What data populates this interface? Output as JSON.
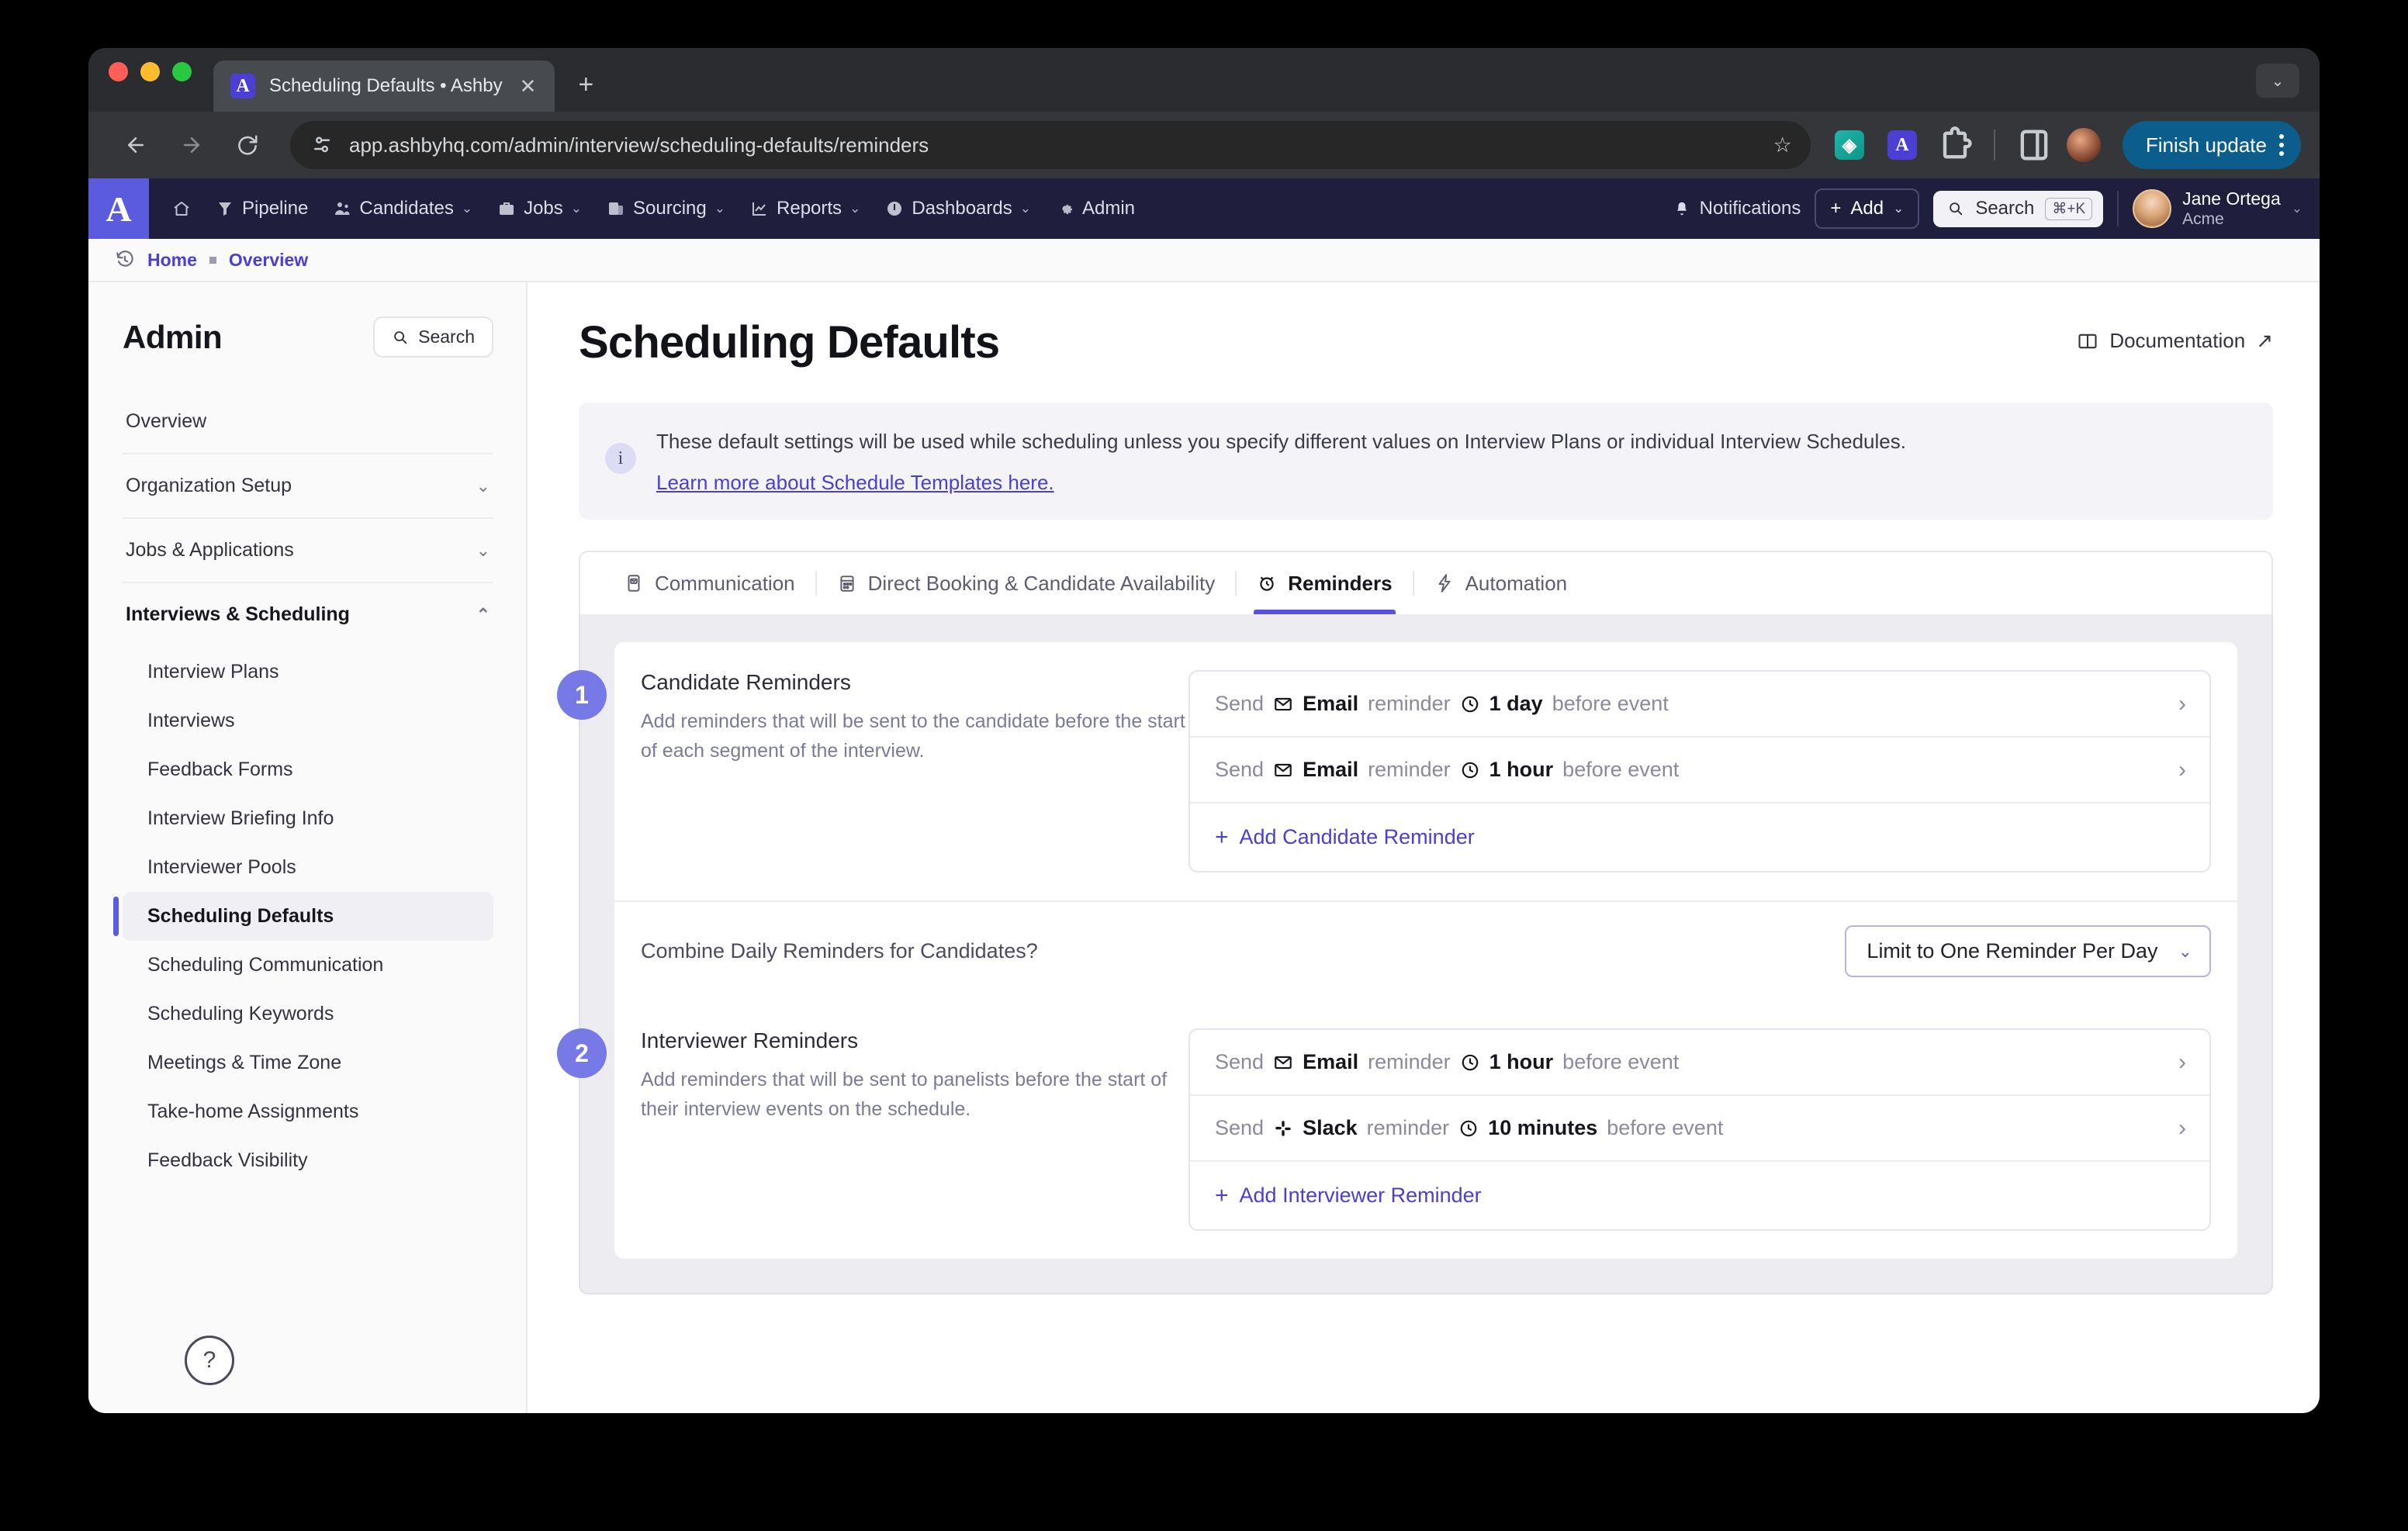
{
  "browser": {
    "tab_title": "Scheduling Defaults • Ashby",
    "tab_favicon_letter": "A",
    "close_icon": "✕",
    "newtab_icon": "+",
    "tabstrip_chevron_icon": "⌄",
    "url": "app.ashbyhq.com/admin/interview/scheduling-defaults/reminders",
    "star_icon": "☆",
    "finish_update_label": "Finish update",
    "extension_teal_glyph": "◈",
    "extension_purple_glyph": "A"
  },
  "appnav": {
    "brand_letter": "A",
    "items": [
      {
        "label": "",
        "icon": "home-icon",
        "caret": ""
      },
      {
        "label": "Pipeline",
        "icon": "funnel-icon",
        "caret": ""
      },
      {
        "label": "Candidates",
        "icon": "people-icon",
        "caret": "⌄"
      },
      {
        "label": "Jobs",
        "icon": "briefcase-icon",
        "caret": "⌄"
      },
      {
        "label": "Sourcing",
        "icon": "sourcing-icon",
        "caret": "⌄"
      },
      {
        "label": "Reports",
        "icon": "chart-icon",
        "caret": "⌄"
      },
      {
        "label": "Dashboards",
        "icon": "gauge-icon",
        "caret": "⌄"
      },
      {
        "label": "Admin",
        "icon": "gear-icon",
        "caret": ""
      }
    ],
    "notifications_label": "Notifications",
    "add_label": "Add",
    "add_plus": "+",
    "add_caret": "⌄",
    "search_label": "Search",
    "search_kbd": "⌘+K",
    "user_name": "Jane Ortega",
    "user_org": "Acme",
    "user_caret": "⌄"
  },
  "breadcrumb": {
    "home": "Home",
    "current": "Overview"
  },
  "sidebar": {
    "title": "Admin",
    "search_label": "Search",
    "groups": [
      {
        "label": "Overview",
        "caret": ""
      },
      {
        "label": "Organization Setup",
        "caret": "⌄"
      },
      {
        "label": "Jobs & Applications",
        "caret": "⌄"
      },
      {
        "label": "Interviews & Scheduling",
        "caret": "⌃"
      }
    ],
    "sub_items": [
      "Interview Plans",
      "Interviews",
      "Feedback Forms",
      "Interview Briefing Info",
      "Interviewer Pools",
      "Scheduling Defaults",
      "Scheduling Communication",
      "Scheduling Keywords",
      "Meetings & Time Zone",
      "Take-home Assignments",
      "Feedback Visibility"
    ],
    "active_sub_item": "Scheduling Defaults",
    "help_label": "?"
  },
  "main": {
    "page_title": "Scheduling Defaults",
    "documentation_label": "Documentation",
    "documentation_arrow": "↗",
    "banner": {
      "icon_letter": "i",
      "text": "These default settings will be used while scheduling unless you specify different values on Interview Plans or individual Interview Schedules.",
      "link": "Learn more about Schedule Templates here."
    },
    "tabs": [
      {
        "label": "Communication",
        "icon": "mail-doc-icon",
        "active": false
      },
      {
        "label": "Direct Booking & Candidate Availability",
        "icon": "calendar-icon",
        "active": false
      },
      {
        "label": "Reminders",
        "icon": "alarm-icon",
        "active": true
      },
      {
        "label": "Automation",
        "icon": "bolt-icon",
        "active": false
      }
    ],
    "sections": [
      {
        "number": "1",
        "title": "Candidate Reminders",
        "description": "Add reminders that will be sent to the candidate before the start of each segment of the interview.",
        "reminders": [
          {
            "send": "Send",
            "channel_icon": "email-icon",
            "channel": "Email",
            "mid": "reminder",
            "time_icon": "clock-icon",
            "time": "1 day",
            "tail": "before event",
            "chevron": "›"
          },
          {
            "send": "Send",
            "channel_icon": "email-icon",
            "channel": "Email",
            "mid": "reminder",
            "time_icon": "clock-icon",
            "time": "1 hour",
            "tail": "before event",
            "chevron": "›"
          }
        ],
        "add_label": "Add Candidate Reminder",
        "add_plus": "+"
      },
      {
        "number": "2",
        "title": "Interviewer Reminders",
        "description": "Add reminders that will be sent to panelists before the start of their interview events on the schedule.",
        "reminders": [
          {
            "send": "Send",
            "channel_icon": "email-icon",
            "channel": "Email",
            "mid": "reminder",
            "time_icon": "clock-icon",
            "time": "1 hour",
            "tail": "before event",
            "chevron": "›"
          },
          {
            "send": "Send",
            "channel_icon": "slack-icon",
            "channel": "Slack",
            "mid": "reminder",
            "time_icon": "clock-icon",
            "time": "10 minutes",
            "tail": "before event",
            "chevron": "›"
          }
        ],
        "add_label": "Add Interviewer Reminder",
        "add_plus": "+"
      }
    ],
    "combine": {
      "label": "Combine Daily Reminders for Candidates?",
      "value": "Limit to One Reminder Per Day",
      "caret": "⌄"
    }
  },
  "colors": {
    "brand_purple": "#5b5be0",
    "link_purple": "#4a3fd0",
    "nav_bg": "#1f1f3d",
    "panel_bg": "#ececf1",
    "step_badge": "#7779e6"
  }
}
